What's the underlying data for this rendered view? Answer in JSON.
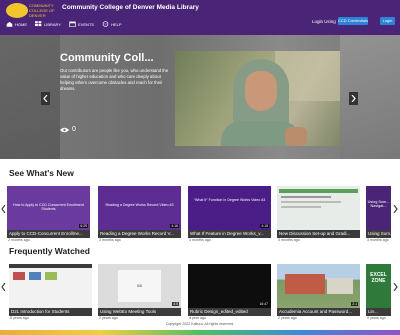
{
  "header": {
    "logo_text": "COMMUNITY COLLEGE OF DENVER",
    "site_title": "Community College of Denver Media Library",
    "nav": [
      {
        "label": "HOME",
        "icon": "home-icon"
      },
      {
        "label": "LIBRARY",
        "icon": "grid-icon"
      },
      {
        "label": "EVENTS",
        "icon": "calendar-icon"
      },
      {
        "label": "HELP",
        "icon": "help-icon"
      }
    ],
    "login_label": "Login Using",
    "login_options": [
      "CCD Credentials",
      "Login"
    ]
  },
  "hero": {
    "title": "Community Coll...",
    "description": "Our contributors are people like you, who understand the value of higher education and who care deeply about helping others overcome obstacles and reach for their dreams.",
    "views": "0"
  },
  "sections": [
    {
      "title": "See What's New",
      "items": [
        {
          "title": "Apply to CCD-Concurrent Enrollme...",
          "age": "2 months ago",
          "duration": "6:29",
          "thumb_text": "How to Apply to CCD Concurrent Enrollment Students"
        },
        {
          "title": "Reading a Degree Works Record V...",
          "age": "3 months ago",
          "duration": "4:16",
          "thumb_text": "Reading a Degree Works Record Video #3"
        },
        {
          "title": "What If Feature in Degree Works_v...",
          "age": "3 months ago",
          "duration": "4:15",
          "thumb_text": "\"What If\" Function in Degree Works Video #3"
        },
        {
          "title": "New Discussion Set-up and Gradi...",
          "age": "3 months ago",
          "duration": "",
          "thumb_text": ""
        },
        {
          "title": "Using Sum...",
          "age": "3 months ago",
          "duration": "",
          "thumb_text": "Using Sum... Navigat..."
        }
      ]
    },
    {
      "title": "Frequently Watched",
      "items": [
        {
          "title": "D2L Introduction for Students",
          "age": "8 years ago",
          "duration": "",
          "thumb_text": ""
        },
        {
          "title": "Using WebEx Meeting Tools",
          "age": "2 years ago",
          "duration": "4:5",
          "thumb_text": "5/6"
        },
        {
          "title": "Rubric Design_edited_edited",
          "age": "a year ago",
          "duration": "16:47",
          "thumb_text": ""
        },
        {
          "title": "Accudemia Account and Password...",
          "age": "2 years ago",
          "duration": "2:1",
          "thumb_text": ""
        },
        {
          "title": "Lin...",
          "age": "9 years ago",
          "duration": "",
          "thumb_text": "EXCEL ZONE"
        }
      ]
    }
  ],
  "footer": {
    "copyright": "Copyright 2022 Kaltura. All rights reserved."
  },
  "colors": {
    "header_bg": "#4a2577",
    "accent_blue": "#2d83d6",
    "logo_gold": "#f3c52c"
  }
}
